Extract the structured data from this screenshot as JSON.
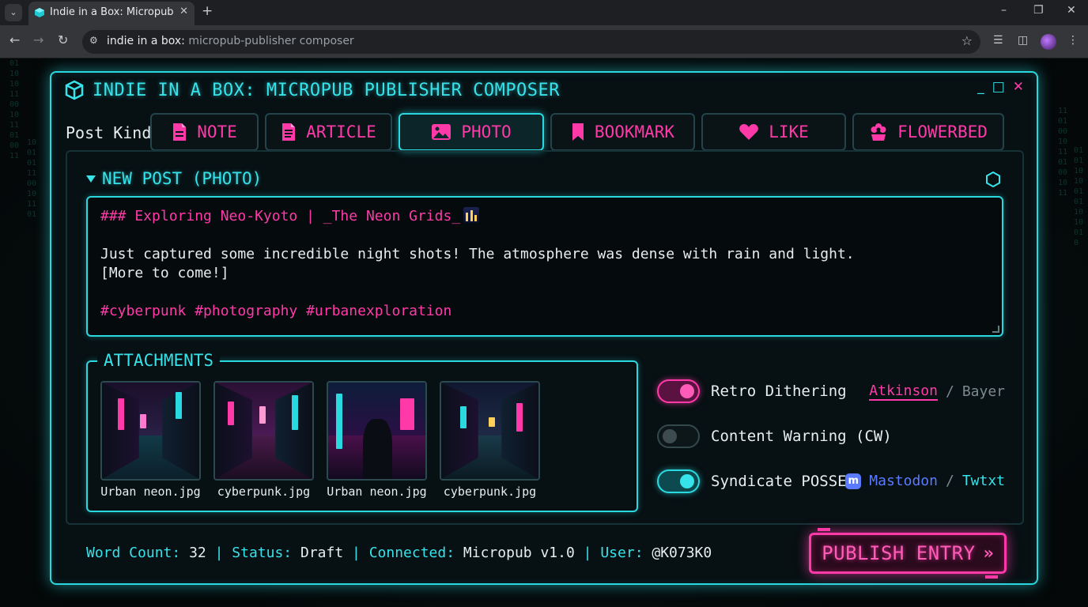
{
  "browser": {
    "tab_title": "Indie in a Box: Micropub",
    "new_tab": "+",
    "url_host": "indie in a box:",
    "url_rest": " micropub-publisher composer",
    "window_controls": [
      "–",
      "❐",
      "✕"
    ]
  },
  "app": {
    "title": "INDIE IN A BOX: MICROPUB PUBLISHER COMPOSER",
    "controls": {
      "minimize": "_",
      "maximize": "□",
      "close": "✕"
    },
    "accent_cyan": "#2ad9e0",
    "accent_pink": "#ff3aa8"
  },
  "post_kind": {
    "label": "Post Kind",
    "kinds": [
      {
        "label": "NOTE",
        "icon": "document-icon",
        "active": false
      },
      {
        "label": "ARTICLE",
        "icon": "document-lines-icon",
        "active": false
      },
      {
        "label": "PHOTO",
        "icon": "image-icon",
        "active": true
      },
      {
        "label": "BOOKMARK",
        "icon": "bookmark-icon",
        "active": false
      },
      {
        "label": "LIKE",
        "icon": "heart-icon",
        "active": false
      },
      {
        "label": "FLOWERBED",
        "icon": "flower-icon",
        "active": false
      }
    ]
  },
  "post": {
    "header": "NEW POST (PHOTO)",
    "editor": {
      "line1": "### Exploring Neo-Kyoto | _The Neon Grids_",
      "line1_emoji": "night-city-emoji",
      "line2": "Just captured some incredible night shots! The atmosphere was dense with rain and light.",
      "line3": "[More to come!]",
      "line4": "#cyberpunk #photography #urbanexploration"
    }
  },
  "attachments": {
    "legend": "ATTACHMENTS",
    "items": [
      {
        "name": "Urban neon.jpg"
      },
      {
        "name": "cyberpunk.jpg"
      },
      {
        "name": "Urban neon.jpg"
      },
      {
        "name": "cyberpunk.jpg"
      }
    ]
  },
  "options": {
    "dithering": {
      "label": "Retro Dithering",
      "on": true,
      "selected": "Atkinson",
      "sep": "/",
      "other": "Bayer"
    },
    "content_warning": {
      "label": "Content Warning (CW)",
      "on": false
    },
    "syndicate": {
      "label": "Syndicate POSSE",
      "on": true,
      "target1": "Mastodon",
      "sep": "/",
      "target2": "Twtxt"
    }
  },
  "status": {
    "word_count_label": "Word Count:",
    "word_count": "32",
    "status_label": "Status:",
    "status": "Draft",
    "connected_label": "Connected:",
    "connected": "Micropub v1.0",
    "user_label": "User:",
    "user": "@K073K0",
    "sep": "|"
  },
  "publish": {
    "label": "PUBLISH ENTRY",
    "arrow": "»"
  }
}
